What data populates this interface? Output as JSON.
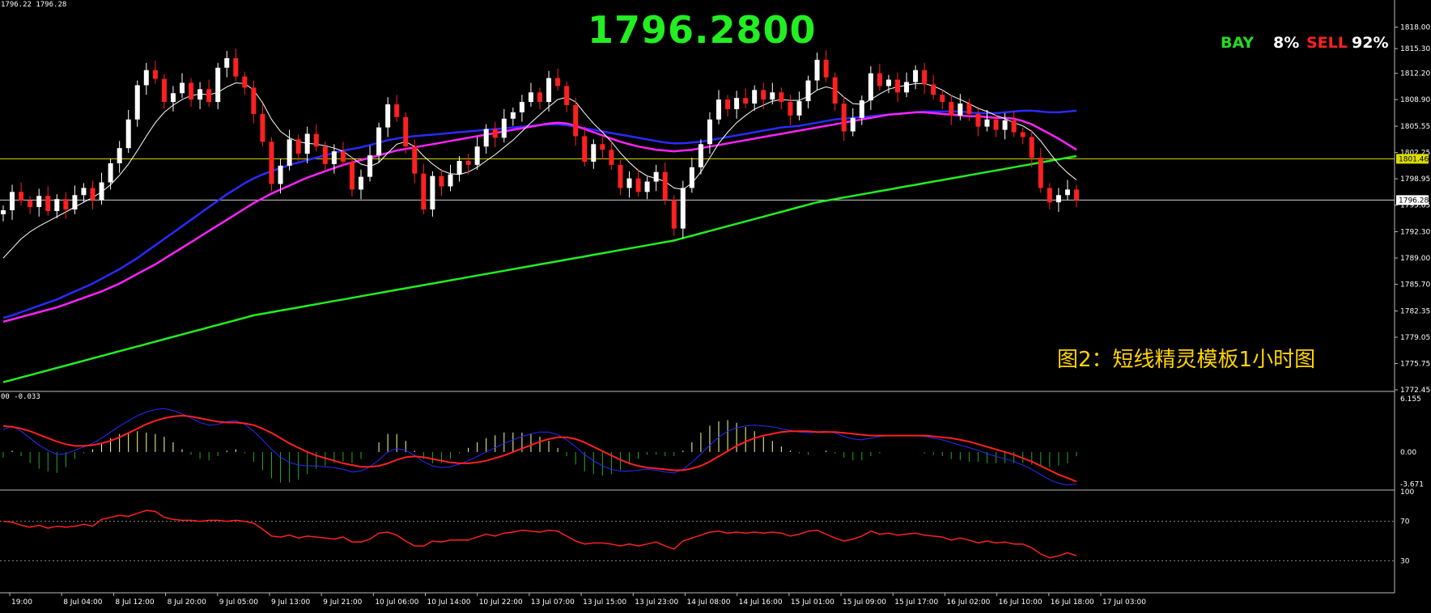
{
  "header": {
    "quote": "1796.22 1796.28",
    "big_price": "1796.2800",
    "bay_label": "BAY",
    "bay_pct": "8%",
    "sell_label": "SELL",
    "sell_pct": "92%",
    "caption": "图2：短线精灵模板1小时图"
  },
  "macd_header": "00 -0.033",
  "colors": {
    "background": "#000000",
    "bull_candle": "#ffffff",
    "bear_candle": "#ff2020",
    "ma_long": "#22ee22",
    "ma_blue": "#2a2aff",
    "ma_magenta": "#ff22ff",
    "green_dots": "#22ee22",
    "red_dots": "#ff2020",
    "level_lines": "#dddd00",
    "labels": "#eeee00",
    "axis_text": "#ffffff"
  },
  "chart_data": [
    {
      "type": "line",
      "title": "",
      "ylim": [
        1772.45,
        1821.0
      ],
      "y_ticks": [
        "1818.00",
        "1815.30",
        "1812.20",
        "1808.90",
        "1805.55",
        "1802.25",
        "1798.95",
        "1795.65",
        "1792.30",
        "1789.00",
        "1785.70",
        "1782.35",
        "1779.05",
        "1775.75",
        "1772.45"
      ],
      "x_ticks": [
        "19:00",
        "8 Jul 04:00",
        "8 Jul 12:00",
        "8 Jul 20:00",
        "9 Jul 05:00",
        "9 Jul 13:00",
        "9 Jul 21:00",
        "10 Jul 06:00",
        "10 Jul 14:00",
        "10 Jul 22:00",
        "13 Jul 07:00",
        "13 Jul 15:00",
        "13 Jul 23:00",
        "14 Jul 08:00",
        "14 Jul 16:00",
        "15 Jul 01:00",
        "15 Jul 09:00",
        "15 Jul 17:00",
        "16 Jul 02:00",
        "16 Jul 10:00",
        "16 Jul 18:00",
        "17 Jul 03:00"
      ],
      "current_price": "1796.28",
      "level_price": "1801.46",
      "close": [
        1795.0,
        1797.3,
        1796.2,
        1795.4,
        1796.8,
        1794.9,
        1796.4,
        1795.1,
        1796.9,
        1797.8,
        1796.3,
        1798.5,
        1800.9,
        1802.8,
        1806.4,
        1810.7,
        1812.6,
        1811.5,
        1808.6,
        1809.7,
        1811.0,
        1808.9,
        1810.2,
        1808.6,
        1812.9,
        1814.1,
        1811.8,
        1810.4,
        1807.1,
        1803.6,
        1798.3,
        1800.6,
        1803.9,
        1802.1,
        1804.6,
        1803.0,
        1800.8,
        1802.4,
        1801.1,
        1797.6,
        1799.2,
        1801.9,
        1805.4,
        1808.3,
        1806.7,
        1803.0,
        1799.6,
        1795.1,
        1799.3,
        1798.0,
        1799.5,
        1801.2,
        1800.7,
        1803.0,
        1805.2,
        1804.1,
        1806.5,
        1807.3,
        1808.6,
        1809.8,
        1808.6,
        1811.6,
        1810.6,
        1808.2,
        1804.3,
        1801.1,
        1803.3,
        1802.6,
        1800.7,
        1797.8,
        1799.0,
        1797.3,
        1798.6,
        1799.8,
        1796.3,
        1792.7,
        1797.8,
        1800.4,
        1803.3,
        1806.4,
        1808.9,
        1807.7,
        1809.1,
        1808.4,
        1810.1,
        1808.9,
        1809.8,
        1808.6,
        1806.9,
        1808.7,
        1811.3,
        1813.9,
        1811.7,
        1808.4,
        1804.9,
        1806.6,
        1808.8,
        1812.2,
        1810.6,
        1811.4,
        1809.8,
        1811.1,
        1812.6,
        1810.8,
        1809.5,
        1808.6,
        1806.9,
        1808.4,
        1807.1,
        1805.5,
        1806.4,
        1805.1,
        1806.3,
        1804.8,
        1804.2,
        1801.6,
        1797.8,
        1796.0,
        1796.9,
        1797.6,
        1796.28
      ],
      "series": [
        {
          "name": "",
          "color": "#22ee22",
          "values": [
            1773.4,
            1773.7,
            1774.0,
            1774.3,
            1774.6,
            1774.9,
            1775.2,
            1775.5,
            1775.8,
            1776.1,
            1776.4,
            1776.7,
            1777.0,
            1777.3,
            1777.6,
            1777.9,
            1778.2,
            1778.5,
            1778.8,
            1779.1,
            1779.4,
            1779.7,
            1780.0,
            1780.3,
            1780.6,
            1780.9,
            1781.2,
            1781.5,
            1781.8,
            1782.0,
            1782.2,
            1782.4,
            1782.6,
            1782.8,
            1783.0,
            1783.2,
            1783.4,
            1783.6,
            1783.8,
            1784.0,
            1784.2,
            1784.4,
            1784.6,
            1784.8,
            1785.0,
            1785.2,
            1785.4,
            1785.6,
            1785.8,
            1786.0,
            1786.2,
            1786.4,
            1786.6,
            1786.8,
            1787.0,
            1787.2,
            1787.4,
            1787.6,
            1787.8,
            1788.0,
            1788.2,
            1788.4,
            1788.6,
            1788.8,
            1789.0,
            1789.2,
            1789.4,
            1789.6,
            1789.8,
            1790.0,
            1790.2,
            1790.4,
            1790.6,
            1790.8,
            1791.0,
            1791.2,
            1791.5,
            1791.8,
            1792.1,
            1792.4,
            1792.7,
            1793.0,
            1793.3,
            1793.6,
            1793.9,
            1794.2,
            1794.5,
            1794.8,
            1795.1,
            1795.4,
            1795.7,
            1796.0,
            1796.2,
            1796.4,
            1796.6,
            1796.8,
            1797.0,
            1797.2,
            1797.4,
            1797.6,
            1797.8,
            1798.0,
            1798.2,
            1798.4,
            1798.6,
            1798.8,
            1799.0,
            1799.2,
            1799.4,
            1799.6,
            1799.8,
            1800.0,
            1800.2,
            1800.4,
            1800.6,
            1800.8,
            1801.0,
            1801.2,
            1801.4,
            1801.6,
            1801.8
          ]
        },
        {
          "name": "",
          "color": "#2a2aff",
          "values": [
            1781.5,
            1781.8,
            1782.2,
            1782.6,
            1783.0,
            1783.4,
            1783.8,
            1784.3,
            1784.8,
            1785.3,
            1785.8,
            1786.4,
            1787.0,
            1787.6,
            1788.3,
            1789.0,
            1789.8,
            1790.6,
            1791.4,
            1792.2,
            1793.0,
            1793.8,
            1794.6,
            1795.4,
            1796.2,
            1797.0,
            1797.7,
            1798.4,
            1799.0,
            1799.5,
            1799.9,
            1800.3,
            1800.7,
            1801.0,
            1801.3,
            1801.6,
            1801.9,
            1802.2,
            1802.5,
            1802.7,
            1802.9,
            1803.2,
            1803.5,
            1803.8,
            1804.0,
            1804.2,
            1804.3,
            1804.4,
            1804.5,
            1804.6,
            1804.7,
            1804.8,
            1804.9,
            1805.0,
            1805.1,
            1805.2,
            1805.3,
            1805.4,
            1805.5,
            1805.6,
            1805.7,
            1805.8,
            1805.8,
            1805.7,
            1805.5,
            1805.3,
            1805.1,
            1804.9,
            1804.7,
            1804.5,
            1804.3,
            1804.1,
            1803.9,
            1803.7,
            1803.5,
            1803.4,
            1803.4,
            1803.5,
            1803.6,
            1803.8,
            1804.0,
            1804.2,
            1804.4,
            1804.6,
            1804.8,
            1805.0,
            1805.2,
            1805.4,
            1805.5,
            1805.6,
            1805.8,
            1806.0,
            1806.2,
            1806.4,
            1806.5,
            1806.6,
            1806.7,
            1806.8,
            1806.9,
            1807.0,
            1807.1,
            1807.2,
            1807.3,
            1807.4,
            1807.4,
            1807.4,
            1807.4,
            1807.4,
            1807.3,
            1807.2,
            1807.2,
            1807.2,
            1807.3,
            1807.4,
            1807.5,
            1807.5,
            1807.4,
            1807.3,
            1807.3,
            1807.4,
            1807.5
          ]
        },
        {
          "name": "",
          "color": "#ff22ff",
          "values": [
            1781.0,
            1781.3,
            1781.6,
            1781.9,
            1782.2,
            1782.5,
            1782.8,
            1783.2,
            1783.6,
            1784.0,
            1784.4,
            1784.8,
            1785.3,
            1785.8,
            1786.4,
            1787.0,
            1787.6,
            1788.2,
            1788.9,
            1789.6,
            1790.3,
            1791.0,
            1791.7,
            1792.4,
            1793.1,
            1793.8,
            1794.5,
            1795.2,
            1795.9,
            1796.5,
            1797.1,
            1797.6,
            1798.1,
            1798.6,
            1799.1,
            1799.5,
            1799.9,
            1800.3,
            1800.7,
            1801.0,
            1801.3,
            1801.6,
            1801.9,
            1802.2,
            1802.5,
            1802.7,
            1802.9,
            1803.1,
            1803.3,
            1803.5,
            1803.7,
            1803.9,
            1804.1,
            1804.3,
            1804.5,
            1804.7,
            1804.9,
            1805.1,
            1805.3,
            1805.5,
            1805.7,
            1805.9,
            1806.0,
            1805.9,
            1805.6,
            1805.2,
            1804.8,
            1804.4,
            1804.0,
            1803.6,
            1803.3,
            1803.0,
            1802.8,
            1802.6,
            1802.5,
            1802.4,
            1802.5,
            1802.6,
            1802.8,
            1803.0,
            1803.2,
            1803.4,
            1803.6,
            1803.8,
            1804.0,
            1804.2,
            1804.4,
            1804.6,
            1804.8,
            1805.0,
            1805.2,
            1805.4,
            1805.6,
            1805.8,
            1806.0,
            1806.2,
            1806.4,
            1806.6,
            1806.8,
            1807.0,
            1807.1,
            1807.2,
            1807.3,
            1807.3,
            1807.2,
            1807.1,
            1807.0,
            1806.9,
            1806.8,
            1806.8,
            1806.7,
            1806.6,
            1806.6,
            1806.5,
            1806.2,
            1805.8,
            1805.2,
            1804.6,
            1804.0,
            1803.3,
            1802.6
          ]
        },
        {
          "name": "",
          "color": "#ffffff",
          "values": [
            1789.0,
            1790.2,
            1791.4,
            1792.3,
            1793.0,
            1793.6,
            1794.2,
            1794.8,
            1795.4,
            1796.0,
            1796.6,
            1797.3,
            1798.2,
            1799.4,
            1800.8,
            1802.5,
            1804.3,
            1806.0,
            1807.3,
            1808.2,
            1808.9,
            1809.4,
            1809.6,
            1809.5,
            1809.8,
            1810.5,
            1811.0,
            1810.9,
            1810.1,
            1808.5,
            1806.4,
            1804.9,
            1804.1,
            1803.6,
            1803.4,
            1803.3,
            1803.1,
            1802.8,
            1802.4,
            1801.6,
            1800.8,
            1800.5,
            1801.0,
            1802.2,
            1803.3,
            1803.6,
            1803.0,
            1801.8,
            1800.8,
            1800.0,
            1799.6,
            1799.5,
            1799.8,
            1800.4,
            1801.2,
            1802.0,
            1802.9,
            1803.8,
            1804.9,
            1806.0,
            1807.0,
            1808.0,
            1808.9,
            1809.2,
            1808.6,
            1807.2,
            1805.9,
            1804.8,
            1803.6,
            1802.2,
            1801.0,
            1800.0,
            1799.3,
            1799.0,
            1798.6,
            1797.8,
            1797.6,
            1798.4,
            1799.8,
            1801.6,
            1803.4,
            1804.8,
            1806.0,
            1806.9,
            1807.7,
            1808.2,
            1808.7,
            1808.9,
            1808.8,
            1808.8,
            1809.3,
            1810.1,
            1810.5,
            1810.2,
            1809.2,
            1808.4,
            1808.3,
            1808.9,
            1809.6,
            1810.2,
            1810.5,
            1810.7,
            1810.9,
            1810.9,
            1810.6,
            1810.1,
            1809.4,
            1808.9,
            1808.4,
            1807.8,
            1807.4,
            1806.9,
            1806.5,
            1806.0,
            1805.6,
            1804.9,
            1803.7,
            1802.2,
            1800.8,
            1799.7,
            1798.8
          ]
        }
      ]
    },
    {
      "type": "bar",
      "title": "",
      "ylim": [
        -4.2,
        6.8
      ],
      "y_ticks": [
        "6.155",
        "0.00",
        "-3.671"
      ],
      "macd_values": [
        2.6,
        3.0,
        2.4,
        1.6,
        0.8,
        0.2,
        -0.3,
        -0.2,
        0.2,
        0.6,
        1.0,
        1.6,
        2.3,
        3.0,
        3.6,
        4.2,
        4.6,
        4.9,
        5.0,
        4.8,
        4.4,
        3.9,
        3.4,
        3.1,
        3.2,
        3.5,
        3.6,
        3.2,
        2.4,
        1.4,
        0.3,
        -0.6,
        -1.2,
        -1.5,
        -1.6,
        -1.6,
        -1.7,
        -1.8,
        -2.0,
        -2.3,
        -2.2,
        -1.7,
        -0.9,
        0.0,
        0.4,
        0.2,
        -0.4,
        -1.1,
        -1.6,
        -1.8,
        -1.7,
        -1.4,
        -1.0,
        -0.5,
        0.0,
        0.5,
        1.0,
        1.4,
        1.8,
        2.1,
        2.3,
        2.3,
        2.0,
        1.4,
        0.6,
        -0.3,
        -1.0,
        -1.6,
        -2.0,
        -2.2,
        -2.2,
        -2.1,
        -2.0,
        -2.1,
        -2.3,
        -2.4,
        -2.0,
        -1.2,
        -0.2,
        0.8,
        1.7,
        2.4,
        2.8,
        3.0,
        3.1,
        3.0,
        2.9,
        2.7,
        2.5,
        2.3,
        2.2,
        2.3,
        2.4,
        2.2,
        1.8,
        1.5,
        1.4,
        1.6,
        1.8,
        1.9,
        1.9,
        1.9,
        1.9,
        1.8,
        1.6,
        1.4,
        1.1,
        0.8,
        0.5,
        0.2,
        -0.2,
        -0.5,
        -0.8,
        -1.1,
        -1.5,
        -2.0,
        -2.6,
        -3.2,
        -3.6,
        -3.8,
        -3.7
      ],
      "signal_values": [
        3.0,
        2.9,
        2.7,
        2.4,
        2.0,
        1.6,
        1.2,
        0.9,
        0.7,
        0.7,
        0.8,
        1.0,
        1.3,
        1.7,
        2.2,
        2.7,
        3.2,
        3.6,
        3.9,
        4.1,
        4.2,
        4.1,
        3.9,
        3.7,
        3.5,
        3.4,
        3.4,
        3.3,
        3.1,
        2.7,
        2.2,
        1.6,
        1.0,
        0.5,
        0.0,
        -0.4,
        -0.7,
        -1.0,
        -1.3,
        -1.5,
        -1.7,
        -1.7,
        -1.6,
        -1.3,
        -0.9,
        -0.6,
        -0.5,
        -0.6,
        -0.8,
        -1.0,
        -1.2,
        -1.3,
        -1.3,
        -1.2,
        -1.0,
        -0.7,
        -0.4,
        0.0,
        0.4,
        0.8,
        1.2,
        1.5,
        1.7,
        1.7,
        1.5,
        1.1,
        0.6,
        0.1,
        -0.4,
        -0.9,
        -1.3,
        -1.6,
        -1.8,
        -1.9,
        -2.0,
        -2.1,
        -2.1,
        -1.9,
        -1.6,
        -1.1,
        -0.5,
        0.1,
        0.7,
        1.2,
        1.6,
        1.9,
        2.1,
        2.3,
        2.4,
        2.4,
        2.4,
        2.3,
        2.3,
        2.3,
        2.2,
        2.1,
        2.0,
        1.9,
        1.9,
        1.9,
        1.9,
        1.9,
        1.9,
        1.9,
        1.8,
        1.7,
        1.6,
        1.4,
        1.2,
        0.9,
        0.6,
        0.3,
        0.0,
        -0.3,
        -0.7,
        -1.1,
        -1.6,
        -2.1,
        -2.6,
        -3.0,
        -3.4
      ]
    },
    {
      "type": "line",
      "title": "",
      "ylim": [
        0,
        100
      ],
      "y_ticks": [
        "100",
        "70",
        "30"
      ],
      "levels": [
        70,
        30
      ],
      "values": [
        70,
        69,
        66,
        64,
        66,
        63,
        65,
        64,
        65,
        67,
        65,
        72,
        74,
        76,
        75,
        78,
        81,
        80,
        74,
        72,
        71,
        71,
        70,
        71,
        71,
        70,
        71,
        70,
        68,
        62,
        55,
        54,
        56,
        53,
        55,
        54,
        53,
        52,
        54,
        49,
        49,
        52,
        58,
        59,
        56,
        50,
        45,
        45,
        50,
        49,
        51,
        51,
        51,
        54,
        57,
        55,
        58,
        59,
        61,
        60,
        59,
        61,
        60,
        55,
        50,
        47,
        48,
        48,
        47,
        45,
        47,
        45,
        47,
        49,
        45,
        42,
        50,
        53,
        56,
        59,
        60,
        58,
        59,
        58,
        59,
        58,
        59,
        58,
        55,
        57,
        60,
        61,
        57,
        53,
        50,
        52,
        55,
        60,
        57,
        58,
        56,
        57,
        58,
        56,
        55,
        54,
        51,
        53,
        51,
        48,
        50,
        48,
        49,
        47,
        47,
        43,
        37,
        33,
        35,
        38,
        35
      ]
    }
  ]
}
